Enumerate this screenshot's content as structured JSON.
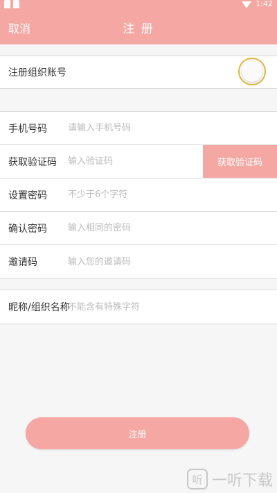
{
  "status": {
    "time": "1:42"
  },
  "header": {
    "cancel_label": "取消",
    "title": "注 册"
  },
  "org_account": {
    "label": "注册组织账号",
    "enabled": false
  },
  "fields": {
    "phone": {
      "label": "手机号码",
      "placeholder": "请输入手机号码",
      "value": ""
    },
    "code": {
      "label": "获取验证码",
      "placeholder": "输入验证码",
      "value": "",
      "button_label": "获取验证码"
    },
    "password": {
      "label": "设置密码",
      "placeholder": "不少于6个字符",
      "value": ""
    },
    "confirm": {
      "label": "确认密码",
      "placeholder": "输入相同的密码",
      "value": ""
    },
    "invite": {
      "label": "邀请码",
      "placeholder": "输入您的邀请码",
      "value": ""
    },
    "nickname": {
      "label": "昵称/组织名称",
      "placeholder": "不能含有特殊字符",
      "value": ""
    }
  },
  "submit_label": "注册",
  "watermark": {
    "logo_glyph": "听",
    "text": "一听下载"
  },
  "colors": {
    "accent": "#f5a8a3",
    "toggle_border": "#e0b53e"
  }
}
